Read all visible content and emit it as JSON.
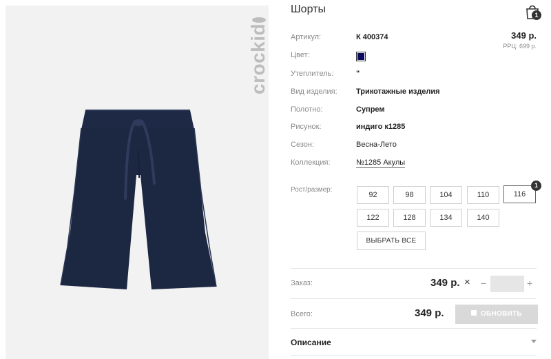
{
  "product": {
    "title": "Шорты",
    "brand": "crockid",
    "image_alt": "shorts"
  },
  "cart": {
    "count": "1"
  },
  "pricing": {
    "price": "349 р.",
    "rrp": "РРЦ: 699 р."
  },
  "attributes": {
    "article_label": "Артикул:",
    "article_value": "К 400374",
    "color_label": "Цвет:",
    "color_hex": "#0d0b5e",
    "insulation_label": "Утеплитель:",
    "insulation_value": "\"",
    "type_label": "Вид изделия:",
    "type_value": "Трикотажные изделия",
    "fabric_label": "Полотно:",
    "fabric_value": "Супрем",
    "pattern_label": "Рисунок:",
    "pattern_value": "индиго к1285",
    "season_label": "Сезон:",
    "season_value": "Весна-Лето",
    "collection_label": "Коллекция:",
    "collection_value": "№1285 Акулы"
  },
  "sizes": {
    "label": "Рост/размер:",
    "options": [
      "92",
      "98",
      "104",
      "110",
      "116",
      "122",
      "128",
      "134",
      "140"
    ],
    "selected": "116",
    "selected_count": "1",
    "select_all_label": "ВЫБРАТЬ ВСЕ"
  },
  "order": {
    "label": "Заказ:",
    "price": "349 р.",
    "remove_icon": "×",
    "minus": "−",
    "plus": "+",
    "quantity": ""
  },
  "total": {
    "label": "Всего:",
    "price": "349 р.",
    "update_label": "ОБНОВИТЬ"
  },
  "description": {
    "heading": "Описание"
  },
  "icons": {
    "cart": "shopping-bag-icon",
    "remove": "close-icon",
    "toggle": "chevron-down-icon"
  }
}
